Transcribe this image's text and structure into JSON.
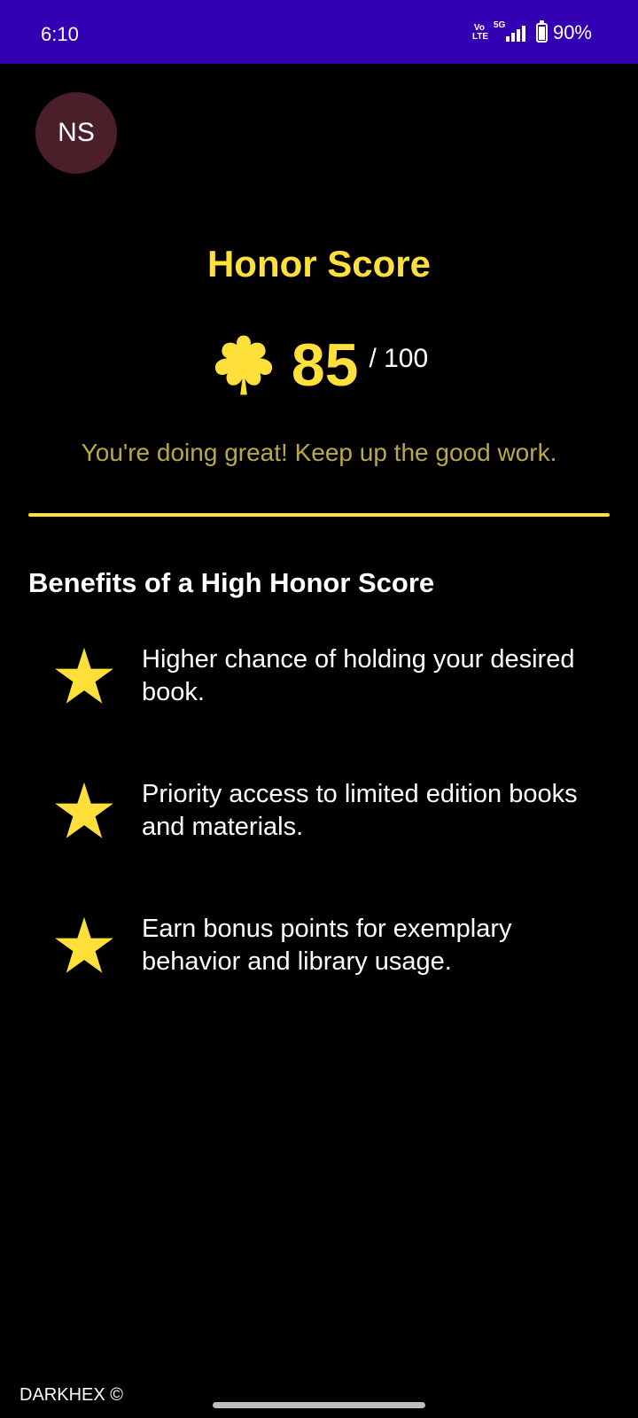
{
  "status_bar": {
    "time": "6:10",
    "volte_label": "Vo\nLTE",
    "network_type": "5G",
    "battery": "90%",
    "background": "#3300b3"
  },
  "profile": {
    "initials": "NS"
  },
  "honor": {
    "title": "Honor Score",
    "score": "85",
    "max": "/ 100",
    "icon": "leaf-badge-icon",
    "message": "You're doing great! Keep up the good work."
  },
  "benefits": {
    "heading": "Benefits of a High Honor Score",
    "items": [
      {
        "icon": "star-icon",
        "text": "Higher chance of holding your desired book."
      },
      {
        "icon": "star-icon",
        "text": "Priority access to limited edition books and materials."
      },
      {
        "icon": "star-icon",
        "text": "Earn bonus points for exemplary behavior and library usage."
      }
    ]
  },
  "footer": {
    "brand": "DARKHEX ©"
  },
  "colors": {
    "accent": "#ffe03a",
    "message": "#b9a845",
    "avatar_bg": "#4a1f2a",
    "background": "#000000"
  }
}
